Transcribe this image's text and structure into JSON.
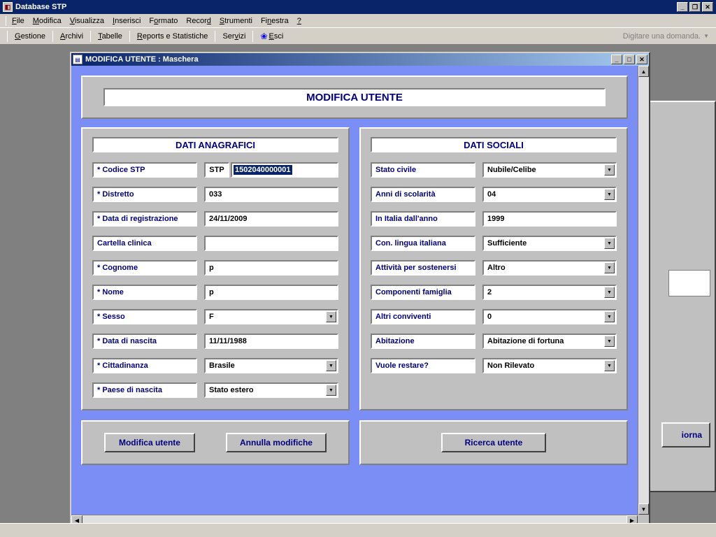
{
  "app": {
    "title": "Database STP"
  },
  "menu": {
    "file": "File",
    "modifica": "Modifica",
    "visualizza": "Visualizza",
    "inserisci": "Inserisci",
    "formato": "Formato",
    "record": "Record",
    "strumenti": "Strumenti",
    "finestra": "Finestra",
    "help": "?"
  },
  "toolbar": {
    "gestione": "Gestione",
    "archivi": "Archivi",
    "tabelle": "Tabelle",
    "reports": "Reports e Statistiche",
    "servizi": "Servizi",
    "esci": "Esci",
    "question": "Digitare una domanda."
  },
  "child": {
    "title": "MODIFICA UTENTE : Maschera"
  },
  "form": {
    "main_title": "MODIFICA UTENTE",
    "left_title": "DATI ANAGRAFICI",
    "right_title": "DATI SOCIALI",
    "stp_prefix": "STP",
    "stp_value": "1502040000001",
    "l_codice": "* Codice STP",
    "l_distretto": "* Distretto",
    "v_distretto": "033",
    "l_datareg": "* Data di registrazione",
    "v_datareg": "24/11/2009",
    "l_cartella": "Cartella clinica",
    "v_cartella": "",
    "l_cognome": "* Cognome",
    "v_cognome": "p",
    "l_nome": "* Nome",
    "v_nome": "p",
    "l_sesso": "* Sesso",
    "v_sesso": "F",
    "l_datanasc": "* Data di nascita",
    "v_datanasc": "11/11/1988",
    "l_citt": "* Cittadinanza",
    "v_citt": "Brasile",
    "l_paese": "* Paese di nascita",
    "v_paese": "Stato estero",
    "l_stato": "Stato civile",
    "v_stato": "Nubile/Celibe",
    "l_anni": "Anni di scolarità",
    "v_anni": "04",
    "l_italia": "In Italia dall'anno",
    "v_italia": "1999",
    "l_lingua": "Con. lingua italiana",
    "v_lingua": "Sufficiente",
    "l_attivita": "Attività per sostenersi",
    "v_attivita": "Altro",
    "l_comp": "Componenti famiglia",
    "v_comp": "2",
    "l_altri": "Altri conviventi",
    "v_altri": "0",
    "l_abit": "Abitazione",
    "v_abit": "Abitazione di fortuna",
    "l_vuole": "Vuole restare?",
    "v_vuole": "Non Rilevato"
  },
  "buttons": {
    "modifica": "Modifica utente",
    "annulla": "Annulla modifiche",
    "ricerca": "Ricerca utente"
  },
  "bg": {
    "hint": "iorna"
  }
}
